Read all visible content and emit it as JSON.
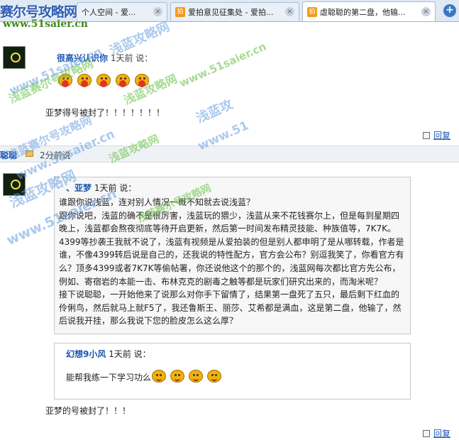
{
  "tabs": [
    {
      "label": "个人空间 - 爱...",
      "active": false,
      "close": "×"
    },
    {
      "label": "爱拍意见征集处 - 爱拍...",
      "active": false,
      "close": "×"
    },
    {
      "label": "虐聪聪的第二盘，他输...",
      "active": true,
      "close": "×"
    }
  ],
  "tab_icon_text": "拍",
  "newtab_symbol": "+",
  "site": {
    "logo": "赛尔号攻略网",
    "url": "www.51saier.cn"
  },
  "watermarks": [
    "浅蓝赛尔号攻略网",
    "www.51saier.cn",
    "浅蓝攻略网",
    "浅蓝攻略网",
    "www.51saier.cn",
    "浅蓝赛尔号攻略网",
    "www.51saier.cn",
    "浅蓝攻",
    "www.51",
    "浅蓝攻略网",
    "www.51saier.cn",
    "浅蓝赛尔号攻略网",
    "浅蓝攻略网"
  ],
  "post1": {
    "username": "很高兴认识你",
    "meta": "1天前 说：",
    "text": "亚梦得号被封了！！！！！！！",
    "reply": "回复"
  },
  "divider": {
    "who": "聪聪",
    "when": "2分前说"
  },
  "post2": {
    "quote": {
      "username": "、亚梦",
      "meta": "1天前 说：",
      "paragraphs": [
        "谁跟你说浅蓝，连对别人情况一概不知就去说浅蓝？",
        "跟你说吧，浅蓝的确不是很厉害，浅蓝玩的猥少，浅蓝从来不花钱赛尔上，但是每到星期四晚上，浅蓝都会熬夜彻底等待开启更新，然后第一时间发布精灵技能、种族值等，7K7K。4399等抄袭王我就不说了，浅蓝有视频是从爱拍装的但是别人都申明了是从哪转载，作者是谁，不像4399转后说是自己的，还我说的特性配方，官方会公布？别逗我笑了，你看官方有么？顶多4399或者7K7K等偷帖署，你还说他这个的那个的，浅蓝网每次都比官方先公布，例如、寄宿岩的本能一击、布林克克的剧毒之触等都是玩家们研究出来的，而淘米呢？",
        "接下说聪聪，一开始他来了说那么对你手下留情了，结果第一盘死了五只，最后剩下红血的伶俐鸟，然后就马上就F5了，我还鲁斯王、丽莎、艾希都是满血，这是第二盘，他输了，然后说我开挂，那么我说下您的脸皮怎么这么厚？"
      ]
    },
    "inner_reply": {
      "username": "幻想9小风",
      "meta": "1天前 说：",
      "text": "能帮我练一下学习功么"
    },
    "text": "亚梦的号被封了！！！",
    "reply": "回复"
  }
}
